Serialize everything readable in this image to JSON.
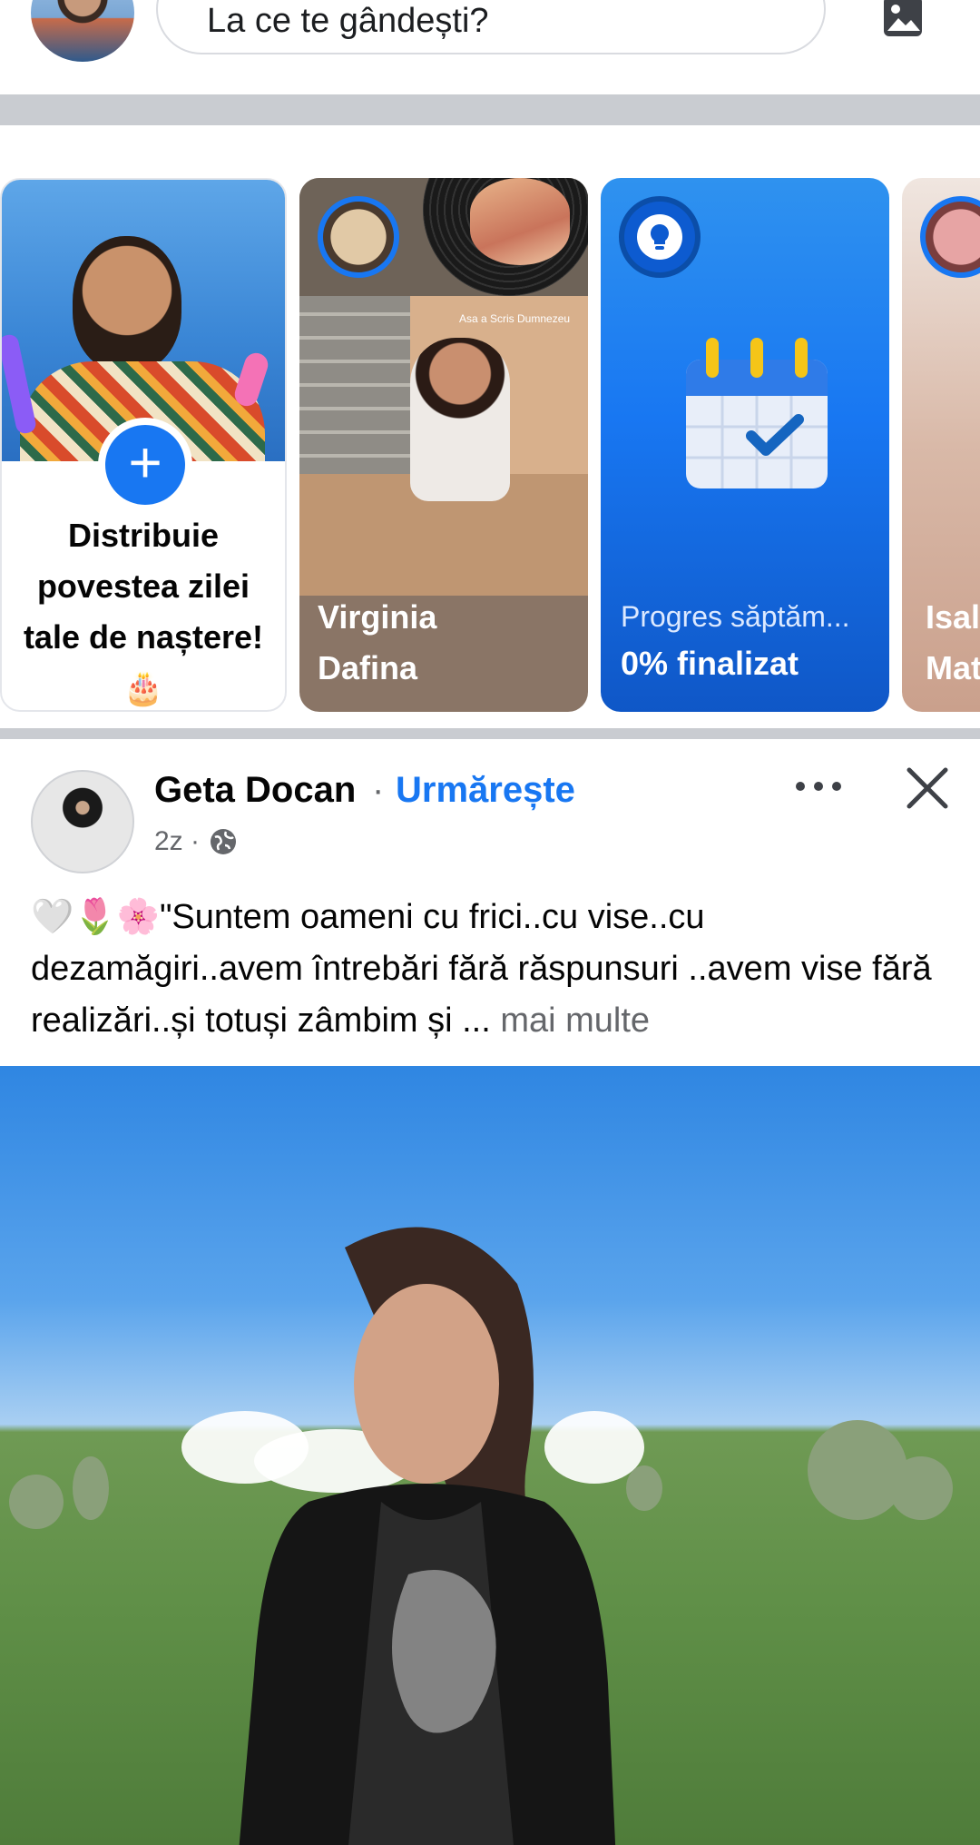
{
  "composer": {
    "placeholder": "La ce te gândești?"
  },
  "stories": [
    {
      "type": "create",
      "label": "Distribuie povestea zilei tale de naștere! 🎂"
    },
    {
      "type": "friend",
      "name_line1": "Virginia",
      "name_line2": "Dafina",
      "overlay_caption": "Asa a Scris Dumnezeu"
    },
    {
      "type": "progress",
      "subtitle": "Progres săptăm...",
      "title": "0% finalizat"
    },
    {
      "type": "friend",
      "name_line1": "Isal",
      "name_line2": "Mat"
    }
  ],
  "post": {
    "author": "Geta Docan",
    "separator": "·",
    "follow_label": "Urmărește",
    "time": "2z ·",
    "text": "🤍🌷🌸\"Suntem oameni cu frici..cu vise..cu dezamăgiri..avem întrebări fără răspunsuri ..avem vise fără realizări..și totuși zâmbim și ...",
    "see_more": "mai multe"
  },
  "colors": {
    "accent": "#1877f2",
    "separator": "#c9ccd1",
    "secondary_text": "#65676b"
  },
  "icons": [
    "photo-icon",
    "plus-icon",
    "lightbulb-icon",
    "calendar-check-icon",
    "more-icon",
    "close-icon",
    "globe-icon"
  ]
}
